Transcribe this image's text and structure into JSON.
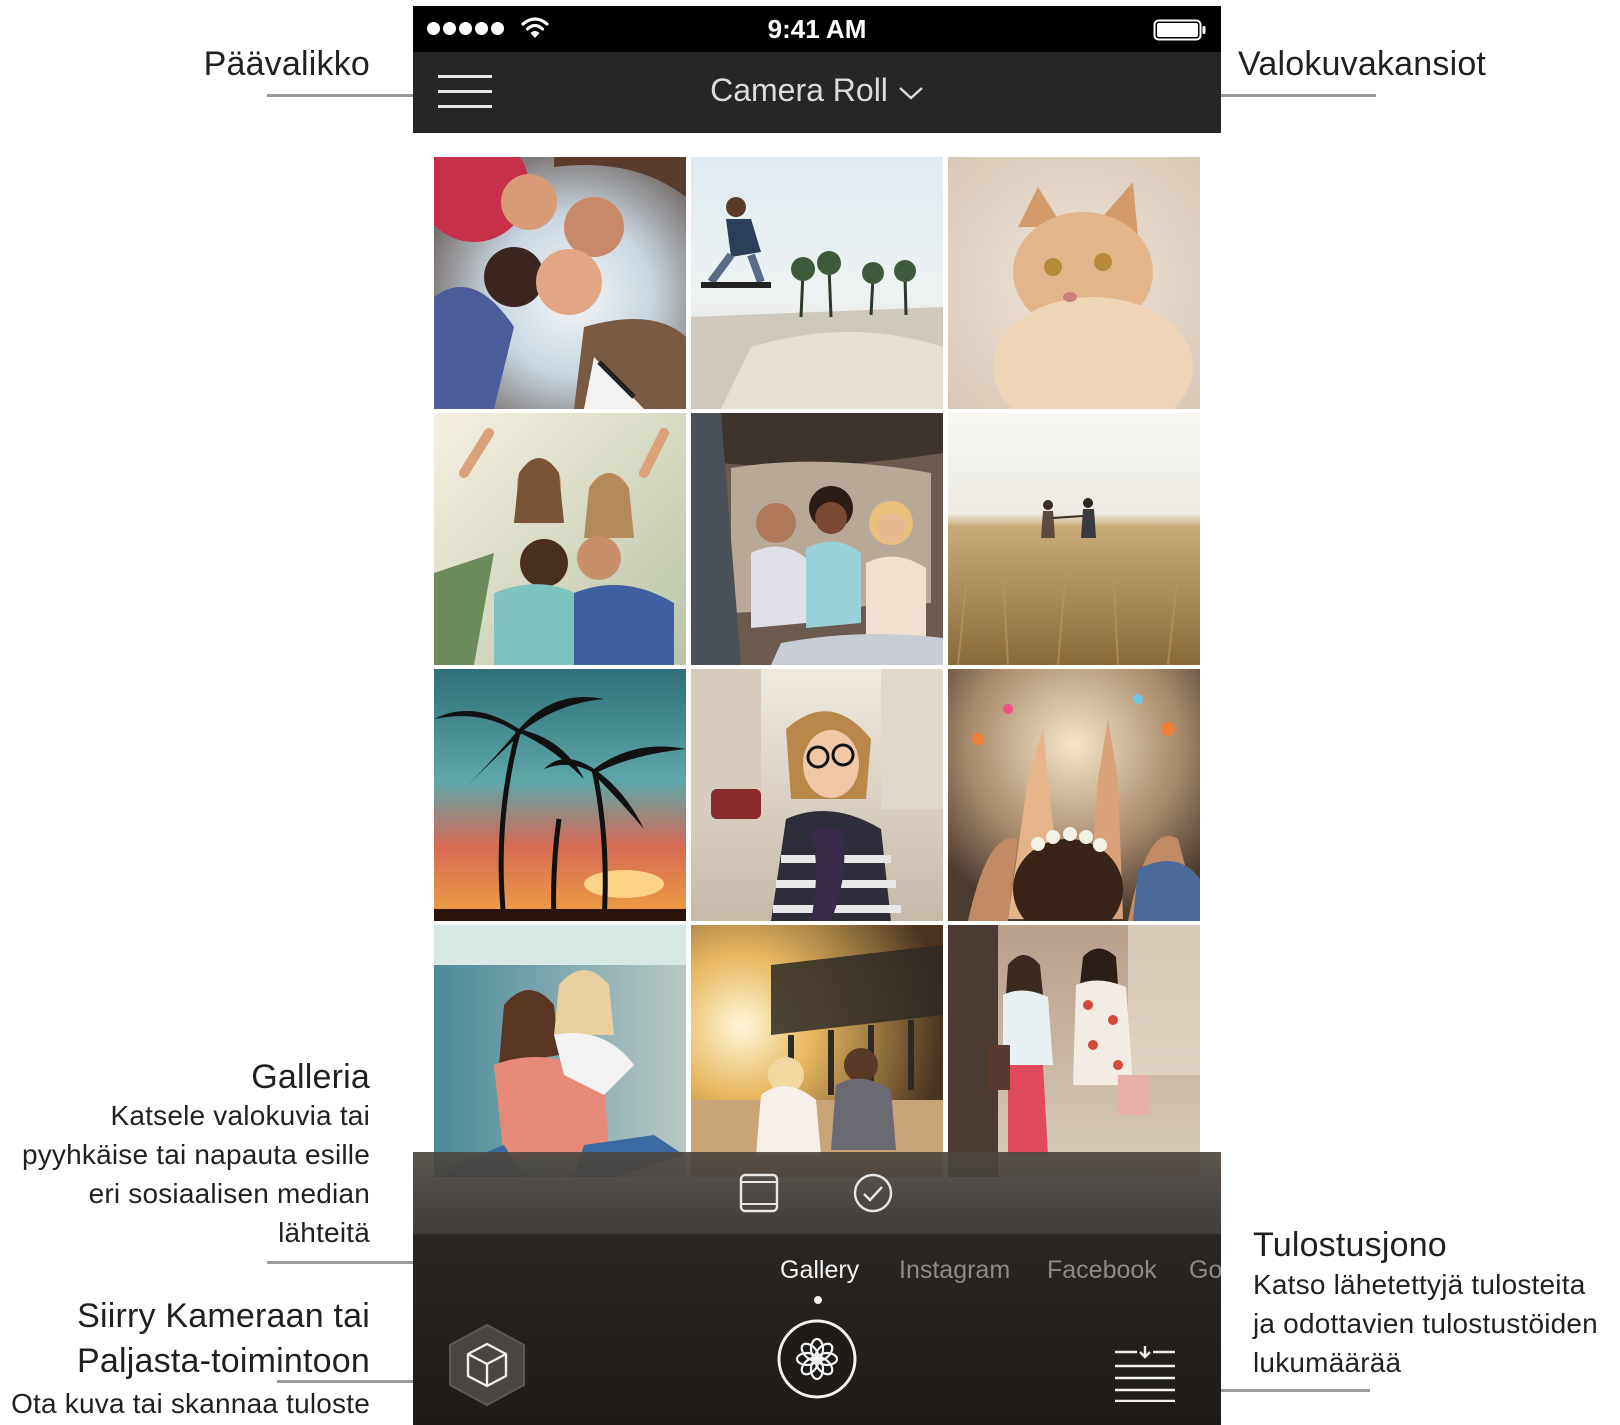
{
  "annotations": {
    "main_menu": {
      "title": "Päävalikko"
    },
    "photo_folders": {
      "title": "Valokuvakansiot"
    },
    "gallery": {
      "title": "Galleria",
      "lines": [
        "Katsele valokuvia tai",
        "pyyhkäise tai napauta esille",
        "eri sosiaalisen median",
        "lähteitä"
      ]
    },
    "camera": {
      "lines": [
        "Siirry Kameraan tai",
        "Paljasta-toimintoon"
      ],
      "body": "Ota kuva tai skannaa tuloste"
    },
    "print_queue": {
      "title": "Tulostusjono",
      "lines": [
        "Katso lähetettyjä tulosteita",
        "ja odottavien tulostustöiden",
        "lukumäärää"
      ]
    }
  },
  "phone": {
    "status_bar": {
      "time": "9:41 AM"
    },
    "nav": {
      "folder_label": "Camera Roll"
    },
    "source_tabs": [
      "Gallery",
      "Instagram",
      "Facebook",
      "Goo"
    ],
    "active_tab": "Gallery",
    "icons": {
      "menu": "hamburger-icon",
      "folder": "chevron-down-icon",
      "print_size": "photo-frame-icon",
      "multi_select": "check-circle-icon",
      "camera": "camera-cube-icon",
      "sprocket": "sprocket-flower-icon",
      "queue": "print-queue-icon"
    }
  },
  "colors": {
    "status_bar": "#000000",
    "nav_bar": "#262626",
    "panel": "#2b2723",
    "leader_line": "#9a9a9a"
  }
}
